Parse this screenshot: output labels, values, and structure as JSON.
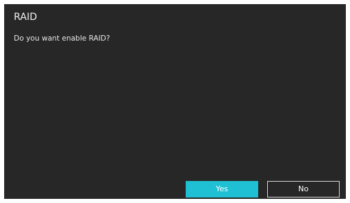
{
  "dialog": {
    "title": "RAID",
    "message": "Do you want enable RAID?",
    "buttons": {
      "yes_label": "Yes",
      "no_label": "No"
    }
  },
  "colors": {
    "background": "#272727",
    "accent": "#1fc0d4",
    "text": "#f2f2f2",
    "button_border": "#d9d9d9"
  }
}
